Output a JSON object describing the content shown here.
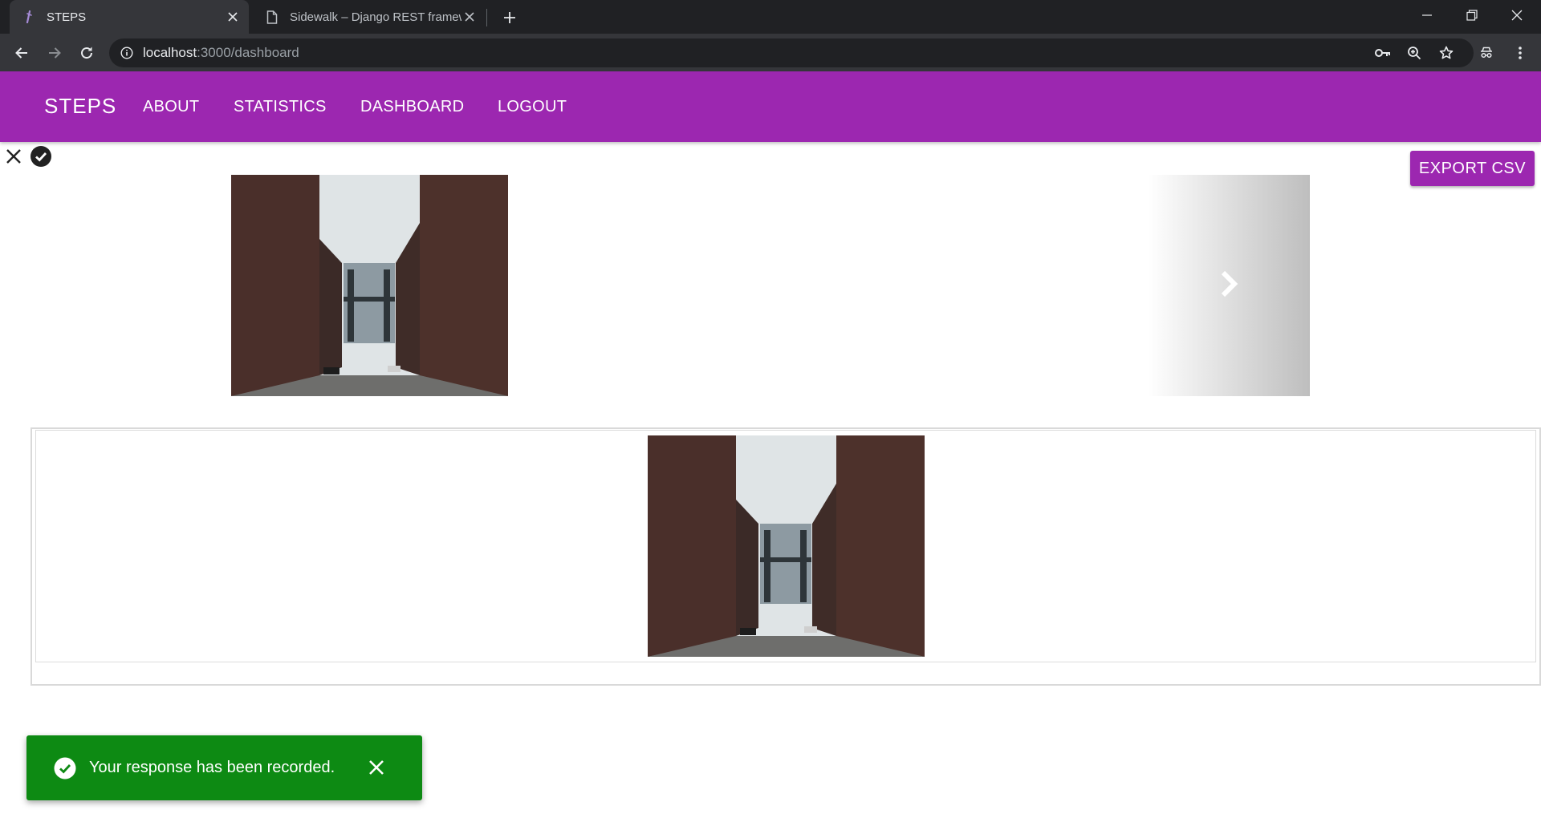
{
  "browser": {
    "tabs": [
      {
        "title": "STEPS",
        "active": true
      },
      {
        "title": "Sidewalk – Django REST framewo",
        "active": false
      }
    ],
    "url_host": "localhost",
    "url_path": ":3000/dashboard"
  },
  "navbar": {
    "brand": "STEPS",
    "links": [
      "ABOUT",
      "STATISTICS",
      "DASHBOARD",
      "LOGOUT"
    ],
    "color": "#9c27b0"
  },
  "actions": {
    "export_label": "EXPORT CSV"
  },
  "toast": {
    "message": "Your response has been recorded.",
    "color": "#0d8a13"
  },
  "icons": {
    "reject": "close-icon",
    "accept": "check-circle-icon",
    "next": "chevron-right-icon"
  }
}
